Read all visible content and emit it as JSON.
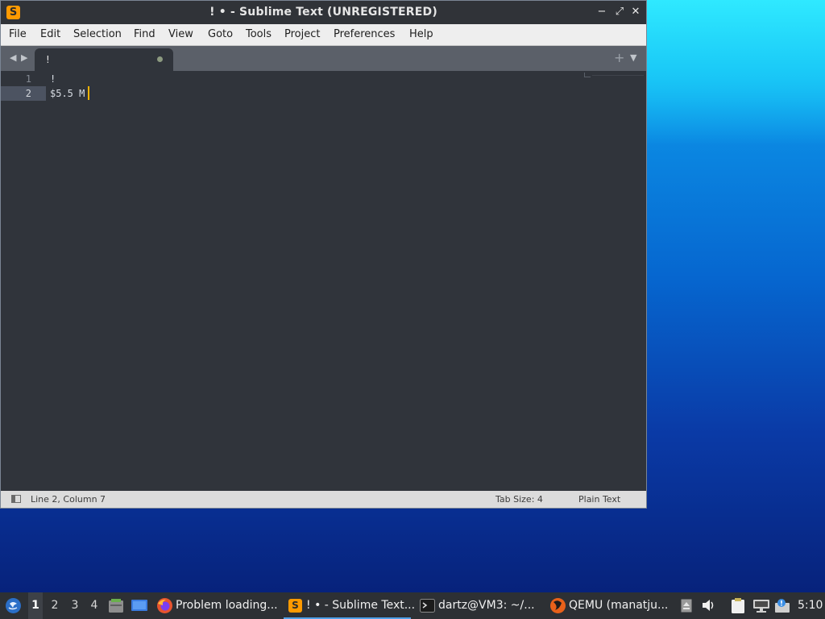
{
  "window": {
    "title": "! • - Sublime Text (UNREGISTERED)",
    "app_icon": "sublime-text-icon",
    "controls": {
      "minimize": "−",
      "maximize": "⤢",
      "close": "✕"
    }
  },
  "menubar": {
    "items": [
      "File",
      "Edit",
      "Selection",
      "Find",
      "View",
      "Goto",
      "Tools",
      "Project",
      "Preferences",
      "Help"
    ]
  },
  "tabbar": {
    "prev_arrow": "◀",
    "next_arrow": "▶",
    "tab": {
      "label": "!",
      "modified": true
    },
    "new_tab": "+",
    "dropdown": "▼"
  },
  "editor": {
    "lines": [
      {
        "number": "1",
        "text": "!"
      },
      {
        "number": "2",
        "text": "$5.5 M"
      }
    ],
    "active_line": 2,
    "cursor_color": "#f7b300"
  },
  "statusbar": {
    "position": "Line 2, Column 7",
    "tab_size": "Tab Size: 4",
    "syntax": "Plain Text"
  },
  "taskbar": {
    "start_icon": "lxqt-menu-icon",
    "workspaces": [
      "1",
      "2",
      "3",
      "4"
    ],
    "active_workspace": "1",
    "quicklaunch_icons": [
      "file-manager-icon",
      "show-desktop-icon"
    ],
    "tasks": [
      {
        "label": "Problem loading...",
        "icon": "firefox-icon"
      },
      {
        "label": "! • - Sublime Text...",
        "icon": "sublime-text-icon",
        "active": true
      },
      {
        "label": "dartz@VM3: ~/...",
        "icon": "terminal-icon"
      },
      {
        "label": "QEMU (manatju...",
        "icon": "qemu-icon"
      }
    ],
    "tray_icons": [
      "eject-icon",
      "volume-icon",
      "clipboard-icon",
      "network-icon",
      "notification-icon",
      "display-icon"
    ],
    "clock": "5:10"
  },
  "colors": {
    "accent": "#4fa0e8",
    "editor_bg": "#30343b",
    "cursor": "#f7b300"
  }
}
